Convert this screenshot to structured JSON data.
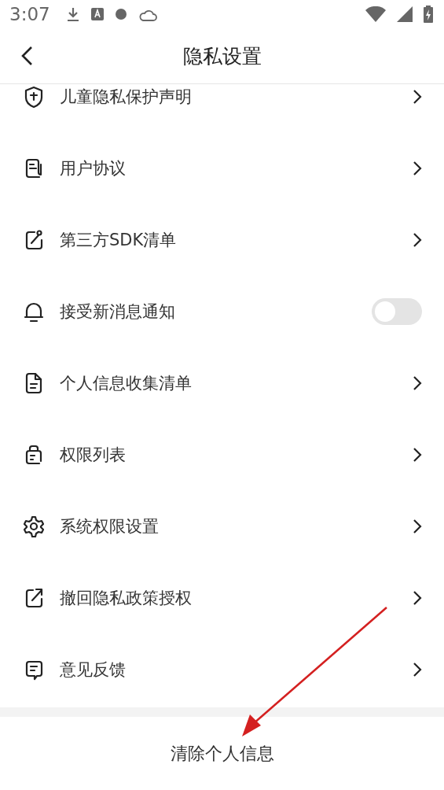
{
  "status_bar": {
    "time": "3:07"
  },
  "header": {
    "title": "隐私设置"
  },
  "items": [
    {
      "label": "儿童隐私保护声明",
      "kind": "link"
    },
    {
      "label": "用户协议",
      "kind": "link"
    },
    {
      "label": "第三方SDK清单",
      "kind": "link"
    },
    {
      "label": "接受新消息通知",
      "kind": "toggle",
      "on": false
    },
    {
      "label": "个人信息收集清单",
      "kind": "link"
    },
    {
      "label": "权限列表",
      "kind": "link"
    },
    {
      "label": "系统权限设置",
      "kind": "link"
    },
    {
      "label": "撤回隐私政策授权",
      "kind": "link"
    },
    {
      "label": "意见反馈",
      "kind": "link"
    }
  ],
  "footer_button": {
    "label": "清除个人信息"
  }
}
